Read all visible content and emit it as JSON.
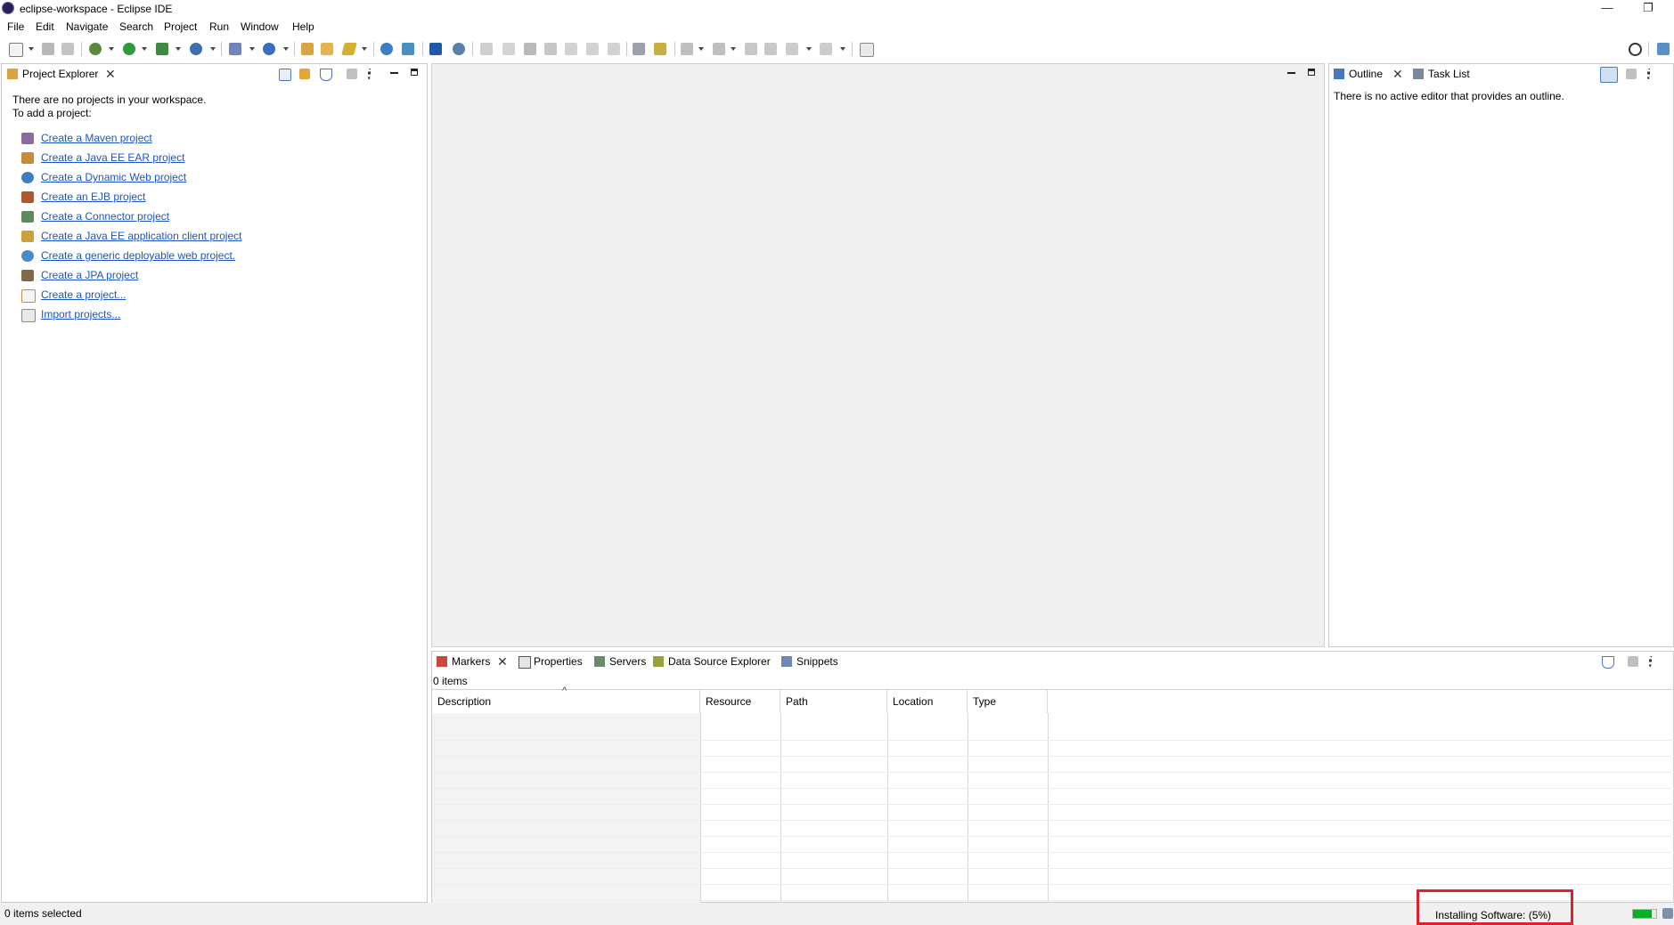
{
  "window": {
    "title": "eclipse-workspace - Eclipse IDE",
    "minimize": "—",
    "restore": "❐"
  },
  "menu": [
    "File",
    "Edit",
    "Navigate",
    "Search",
    "Project",
    "Run",
    "Window",
    "Help"
  ],
  "project_explorer": {
    "tab": "Project Explorer",
    "message_line1": "There are no projects in your workspace.",
    "message_line2": "To add a project:",
    "links": [
      "Create a Maven project",
      "Create a Java EE EAR project",
      "Create a Dynamic Web project",
      "Create an EJB project",
      "Create a Connector project",
      "Create a Java EE application client project",
      "Create a generic deployable web project.",
      "Create a JPA project",
      "Create a project...",
      "Import projects..."
    ]
  },
  "outline": {
    "tabs": [
      "Outline",
      "Task List"
    ],
    "message": "There is no active editor that provides an outline."
  },
  "bottom": {
    "tabs": [
      "Markers",
      "Properties",
      "Servers",
      "Data Source Explorer",
      "Snippets"
    ],
    "items_count": "0 items",
    "columns": [
      "Description",
      "Resource",
      "Path",
      "Location",
      "Type"
    ],
    "sort_indicator": "^"
  },
  "status": {
    "selection": "0 items selected",
    "progress_text": "Installing Software: (5%)",
    "progress_fraction": 0.05,
    "highlight_color": "#e0202a",
    "progress_color": "#06b025"
  }
}
